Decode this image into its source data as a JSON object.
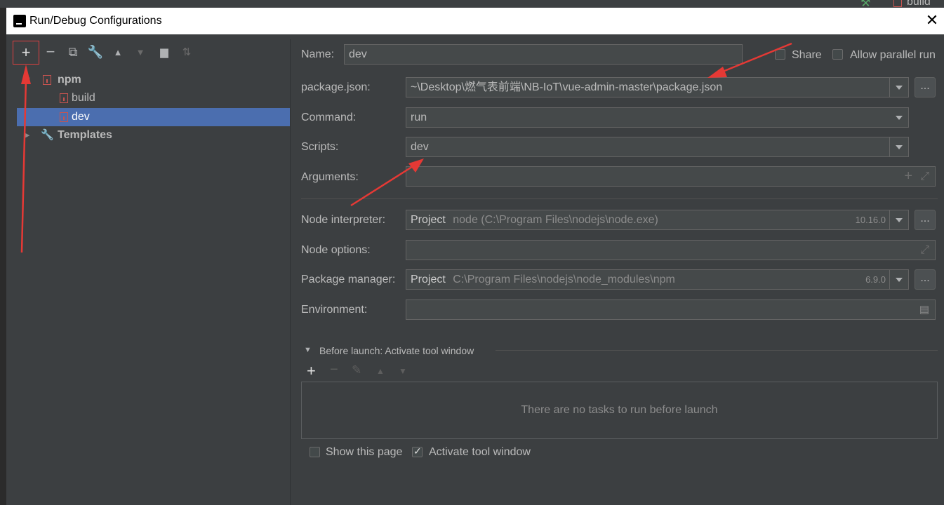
{
  "dialog": {
    "title": "Run/Debug Configurations"
  },
  "background": {
    "top_right_tab": "build"
  },
  "tree": {
    "group_label": "npm",
    "items": [
      "build",
      "dev"
    ],
    "templates_label": "Templates"
  },
  "form": {
    "name_label": "Name:",
    "name_value": "dev",
    "share_label": "Share",
    "allow_parallel_label": "Allow parallel run",
    "package_json_label": "package.json:",
    "package_json_value": "~\\Desktop\\燃气表前端\\NB-IoT\\vue-admin-master\\package.json",
    "command_label": "Command:",
    "command_value": "run",
    "scripts_label": "Scripts:",
    "scripts_value": "dev",
    "arguments_label": "Arguments:",
    "node_interpreter_label": "Node interpreter:",
    "node_interpreter_prefix": "Project",
    "node_interpreter_path": "node (C:\\Program Files\\nodejs\\node.exe)",
    "node_interpreter_version": "10.16.0",
    "node_options_label": "Node options:",
    "package_manager_label": "Package manager:",
    "package_manager_prefix": "Project",
    "package_manager_path": "C:\\Program Files\\nodejs\\node_modules\\npm",
    "package_manager_version": "6.9.0",
    "environment_label": "Environment:",
    "dots_label": "..."
  },
  "before_launch": {
    "title": "Before launch: Activate tool window",
    "empty_text": "There are no tasks to run before launch",
    "show_page_label": "Show this page",
    "activate_window_label": "Activate tool window"
  },
  "colors": {
    "dialog_bg": "#3c3f41",
    "selection": "#4b6eaf",
    "annotation": "#e53935"
  }
}
